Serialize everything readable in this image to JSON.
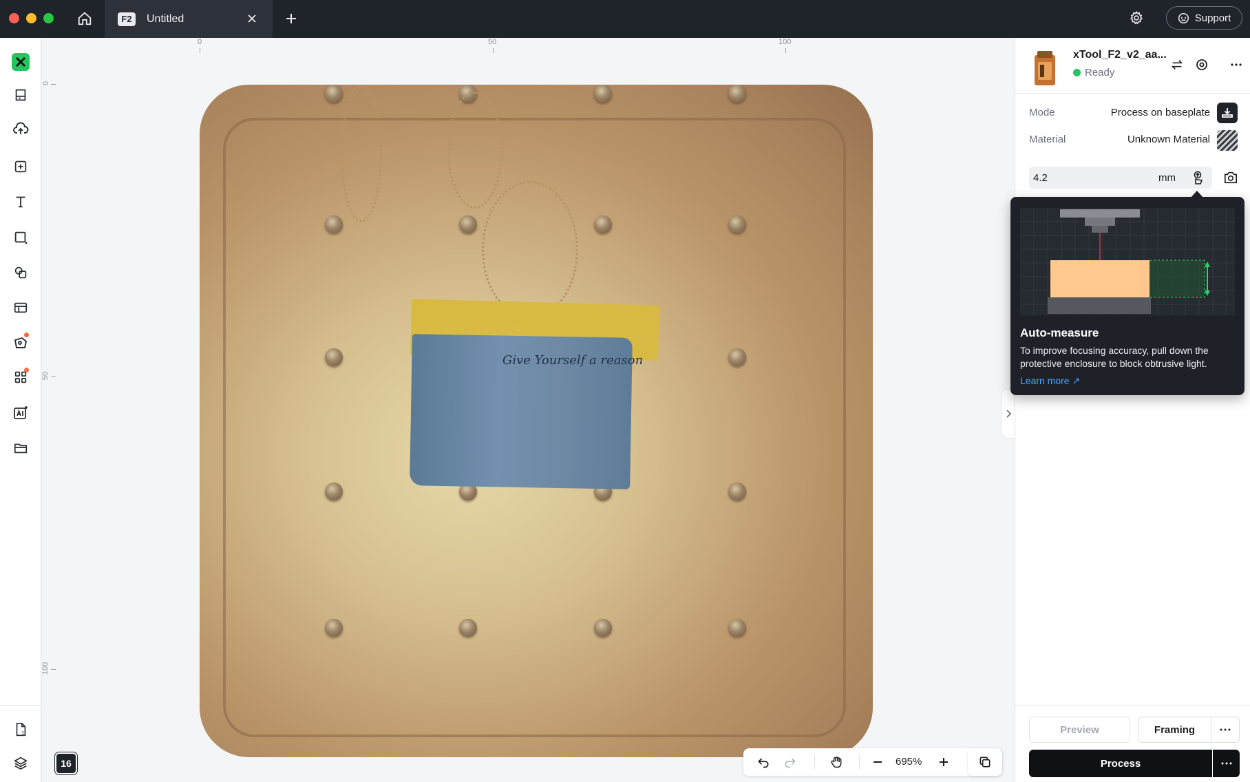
{
  "titlebar": {
    "tab_badge": "F2",
    "tab_title": "Untitled",
    "support_label": "Support"
  },
  "canvas": {
    "ruler_h": [
      "0",
      "50",
      "100"
    ],
    "ruler_v": [
      "0",
      "50",
      "100"
    ],
    "image_text": "Give Yourself a reason",
    "layer_badge": "16",
    "zoom_level": "695%"
  },
  "device": {
    "name": "xTool_F2_v2_aa...",
    "status": "Ready",
    "status_color": "#22c55e"
  },
  "settings": {
    "mode_label": "Mode",
    "mode_value": "Process on baseplate",
    "material_label": "Material",
    "material_value": "Unknown Material",
    "focus_value": "4.2",
    "focus_unit": "mm"
  },
  "tooltip": {
    "title": "Auto-measure",
    "body": "To improve focusing accuracy, pull down the protective enclosure to block obtrusive light.",
    "link": "Learn more ↗"
  },
  "actions": {
    "preview": "Preview",
    "framing": "Framing",
    "process": "Process"
  },
  "colors": {
    "titlebar_bg": "#1f232a",
    "accent_green": "#22c55e",
    "link_blue": "#4aa3ff",
    "tooltip_bg": "#1e2228"
  }
}
